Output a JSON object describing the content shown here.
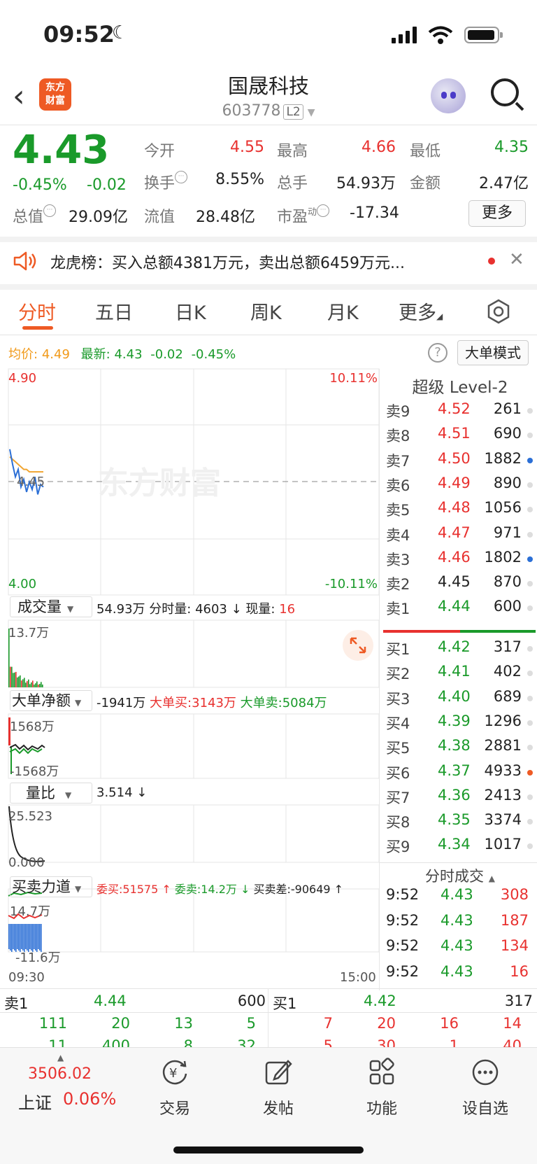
{
  "status_bar": {
    "time": "09:52"
  },
  "header": {
    "logo_line1": "东方",
    "logo_line2": "财富",
    "stock_name": "国晟科技",
    "stock_code": "603778",
    "level_badge": "L2"
  },
  "quote": {
    "price": "4.43",
    "change_pct": "-0.45%",
    "change": "-0.02",
    "open_label": "今开",
    "open": "4.55",
    "high_label": "最高",
    "high": "4.66",
    "low_label": "最低",
    "low": "4.35",
    "turnover_label": "换手",
    "turnover": "8.55%",
    "volume_label": "总手",
    "volume": "54.93万",
    "amount_label": "金额",
    "amount": "2.47亿",
    "mktcap_label": "总值",
    "mktcap": "29.09亿",
    "float_label": "流值",
    "float_cap": "28.48亿",
    "pe_label": "市盈",
    "pe_sup": "动",
    "pe": "-17.34",
    "more_label": "更多"
  },
  "news": {
    "text": "龙虎榜：买入总额4381万元，卖出总额6459万元..."
  },
  "tabs": [
    "分时",
    "五日",
    "日K",
    "周K",
    "月K",
    "更多"
  ],
  "chart_header": {
    "avg_label": "均价:",
    "avg": "4.49",
    "latest_label": "最新:",
    "latest": "4.43",
    "latest_change": "-0.02",
    "latest_pct": "-0.45%",
    "mode_button": "大单模式"
  },
  "chart_data": {
    "type": "line",
    "title": "",
    "y_top": "4.90",
    "y_mid": "4.45",
    "y_bottom": "4.00",
    "pct_top": "10.11%",
    "pct_bottom": "-10.11%",
    "ylim": [
      4.0,
      4.9
    ],
    "reference_price": 4.45,
    "x_start": "09:30",
    "x_end": "15:00",
    "watermark": "东方财富",
    "series": [
      {
        "values": [
          4.58,
          4.52,
          4.47,
          4.5,
          4.43,
          4.46,
          4.41,
          4.45,
          4.42,
          4.47,
          4.4,
          4.44,
          4.43
        ]
      },
      {
        "values": [
          4.55,
          4.54,
          4.53,
          4.52,
          4.51,
          4.5,
          4.5,
          4.49,
          4.49,
          4.49,
          4.49,
          4.49,
          4.49
        ]
      }
    ]
  },
  "indicators": {
    "vol_label": "成交量",
    "vol_total": "54.93万",
    "vol_min_label": "分时量:",
    "vol_min": "4603",
    "vol_cur_label": "现量:",
    "vol_cur": "16",
    "vol_max": "13.7万",
    "net_label": "大单净额",
    "net_value": "-1941万",
    "net_buy": "大单买:3143万",
    "net_sell": "大单卖:5084万",
    "net_top": "1568万",
    "net_bottom": "-1568万",
    "ratio_label": "量比",
    "ratio_value": "3.514",
    "ratio_top": "25.523",
    "ratio_bottom": "0.000",
    "force_label": "买卖力道",
    "force_buy": "委买:51575",
    "force_sell": "委卖:14.2万",
    "force_diff": "买卖差:-90649",
    "force_top": "14.7万",
    "force_bottom": "-11.6万"
  },
  "order_book": {
    "title": "超级 Level-2",
    "asks": [
      {
        "label": "卖9",
        "price": "4.52",
        "vol": "261",
        "dot": "#dddddd"
      },
      {
        "label": "卖8",
        "price": "4.51",
        "vol": "690",
        "dot": "#dddddd"
      },
      {
        "label": "卖7",
        "price": "4.50",
        "vol": "1882",
        "dot": "#2b6fd6"
      },
      {
        "label": "卖6",
        "price": "4.49",
        "vol": "890",
        "dot": "#dddddd"
      },
      {
        "label": "卖5",
        "price": "4.48",
        "vol": "1056",
        "dot": "#dddddd"
      },
      {
        "label": "卖4",
        "price": "4.47",
        "vol": "971",
        "dot": "#dddddd"
      },
      {
        "label": "卖3",
        "price": "4.46",
        "vol": "1802",
        "dot": "#2b6fd6"
      },
      {
        "label": "卖2",
        "price": "4.45",
        "vol": "870",
        "dot": "#dddddd"
      },
      {
        "label": "卖1",
        "price": "4.44",
        "vol": "600",
        "dot": "#dddddd"
      }
    ],
    "bids": [
      {
        "label": "买1",
        "price": "4.42",
        "vol": "317",
        "dot": "#dddddd"
      },
      {
        "label": "买2",
        "price": "4.41",
        "vol": "402",
        "dot": "#dddddd"
      },
      {
        "label": "买3",
        "price": "4.40",
        "vol": "689",
        "dot": "#dddddd"
      },
      {
        "label": "买4",
        "price": "4.39",
        "vol": "1296",
        "dot": "#dddddd"
      },
      {
        "label": "买5",
        "price": "4.38",
        "vol": "2881",
        "dot": "#dddddd"
      },
      {
        "label": "买6",
        "price": "4.37",
        "vol": "4933",
        "dot": "#ee5a24"
      },
      {
        "label": "买7",
        "price": "4.36",
        "vol": "2413",
        "dot": "#dddddd"
      },
      {
        "label": "买8",
        "price": "4.35",
        "vol": "3374",
        "dot": "#dddddd"
      },
      {
        "label": "买9",
        "price": "4.34",
        "vol": "1017",
        "dot": "#dddddd"
      }
    ]
  },
  "ticks": {
    "title": "分时成交",
    "rows": [
      {
        "time": "9:52",
        "price": "4.43",
        "vol": "308"
      },
      {
        "time": "9:52",
        "price": "4.43",
        "vol": "187"
      },
      {
        "time": "9:52",
        "price": "4.43",
        "vol": "134"
      },
      {
        "time": "9:52",
        "price": "4.43",
        "vol": "16"
      }
    ]
  },
  "level1": {
    "ask_label": "卖1",
    "ask_price": "4.44",
    "ask_vol": "600",
    "bid_label": "买1",
    "bid_price": "4.42",
    "bid_vol": "317",
    "ask_row1": [
      "111",
      "20",
      "13",
      "5"
    ],
    "ask_row2": [
      "11",
      "400",
      "8",
      "32"
    ],
    "bid_row1": [
      "7",
      "20",
      "16",
      "14"
    ],
    "bid_row2": [
      "5",
      "30",
      "1",
      "40"
    ]
  },
  "bottom_nav": {
    "index_value": "3506.02",
    "index_name": "上证",
    "index_pct": "0.06%",
    "items": [
      "交易",
      "发帖",
      "功能",
      "设自选"
    ]
  }
}
